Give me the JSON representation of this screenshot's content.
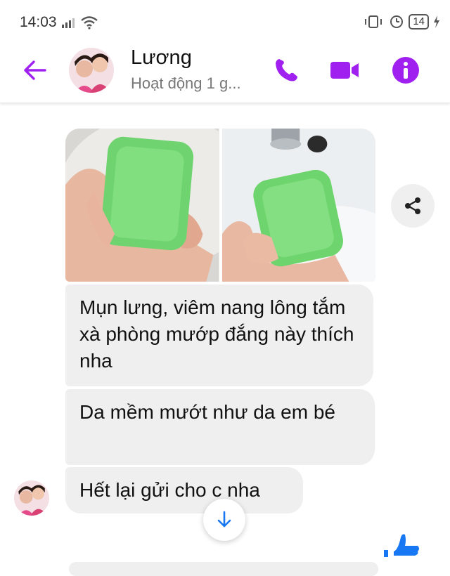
{
  "status": {
    "time": "14:03",
    "battery": "14"
  },
  "header": {
    "back_icon": "arrow-left-icon",
    "name": "Lương",
    "subtitle": "Hoạt động 1 g...",
    "call_icon": "phone-icon",
    "video_icon": "video-camera-icon",
    "info_icon": "info-icon",
    "accent": "#a020f0"
  },
  "messages": [
    {
      "text": "Mụn lưng, viêm nang lông tắm xà phòng mướp đắng này thích nha"
    },
    {
      "text": "Da mềm mướt như da em bé"
    },
    {
      "text": "Hết lại gửi cho c nha"
    }
  ],
  "photos": [
    {
      "alt": "green-soap-in-hand"
    },
    {
      "alt": "green-soap-under-faucet"
    }
  ],
  "share_icon": "share-icon",
  "scroll_icon": "arrow-down-icon",
  "like_icon": "thumbs-up-icon"
}
